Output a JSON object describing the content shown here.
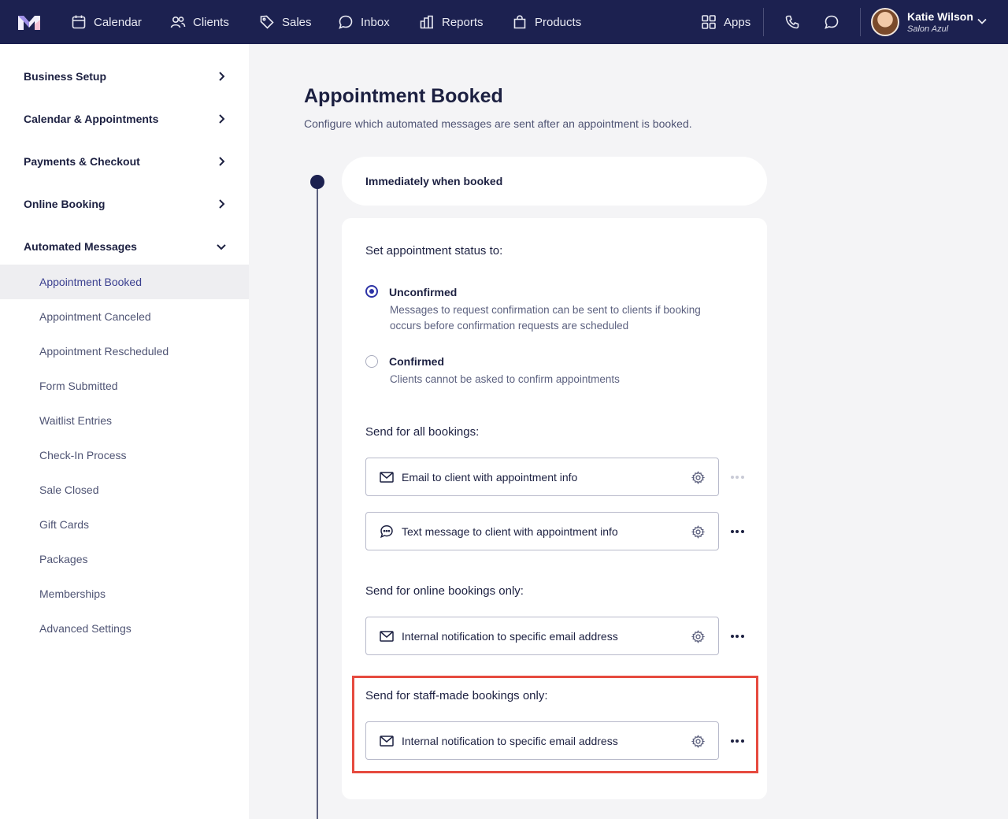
{
  "topbar": {
    "nav": [
      {
        "label": "Calendar",
        "icon": "calendar-icon"
      },
      {
        "label": "Clients",
        "icon": "users-icon"
      },
      {
        "label": "Sales",
        "icon": "tag-icon"
      },
      {
        "label": "Inbox",
        "icon": "inbox-icon"
      },
      {
        "label": "Reports",
        "icon": "reports-icon"
      },
      {
        "label": "Products",
        "icon": "shopping-bag-icon"
      }
    ],
    "apps_label": "Apps",
    "user": {
      "name": "Katie Wilson",
      "business": "Salon Azul"
    }
  },
  "sidebar": {
    "sections": [
      {
        "label": "Business Setup",
        "expanded": false
      },
      {
        "label": "Calendar & Appointments",
        "expanded": false
      },
      {
        "label": "Payments & Checkout",
        "expanded": false
      },
      {
        "label": "Online Booking",
        "expanded": false
      },
      {
        "label": "Automated Messages",
        "expanded": true
      }
    ],
    "sub_items": [
      "Appointment Booked",
      "Appointment Canceled",
      "Appointment Rescheduled",
      "Form Submitted",
      "Waitlist Entries",
      "Check-In Process",
      "Sale Closed",
      "Gift Cards",
      "Packages",
      "Memberships",
      "Advanced Settings"
    ],
    "active_item": "Appointment Booked"
  },
  "page": {
    "title": "Appointment Booked",
    "subtitle": "Configure which automated messages are sent after an appointment is booked.",
    "trigger_label": "Immediately when booked",
    "status_heading": "Set appointment status to:",
    "status_options": [
      {
        "label": "Unconfirmed",
        "description": "Messages to request confirmation can be sent to clients if booking occurs before confirmation requests are scheduled",
        "selected": true
      },
      {
        "label": "Confirmed",
        "description": "Clients cannot be asked to confirm appointments",
        "selected": false
      }
    ],
    "groups": [
      {
        "heading": "Send for all bookings:",
        "messages": [
          {
            "icon": "envelope-icon",
            "label": "Email to client with appointment info"
          },
          {
            "icon": "chat-bubble-icon",
            "label": "Text message to client with appointment info"
          }
        ]
      },
      {
        "heading": "Send for online bookings only:",
        "messages": [
          {
            "icon": "envelope-icon",
            "label": "Internal notification to specific email address"
          }
        ]
      },
      {
        "heading": "Send for staff-made bookings only:",
        "messages": [
          {
            "icon": "envelope-icon",
            "label": "Internal notification to specific email address"
          }
        ]
      }
    ],
    "highlight_color": "#e64a3f",
    "accent_color": "#2d33a6",
    "brand_color": "#1c2150"
  }
}
